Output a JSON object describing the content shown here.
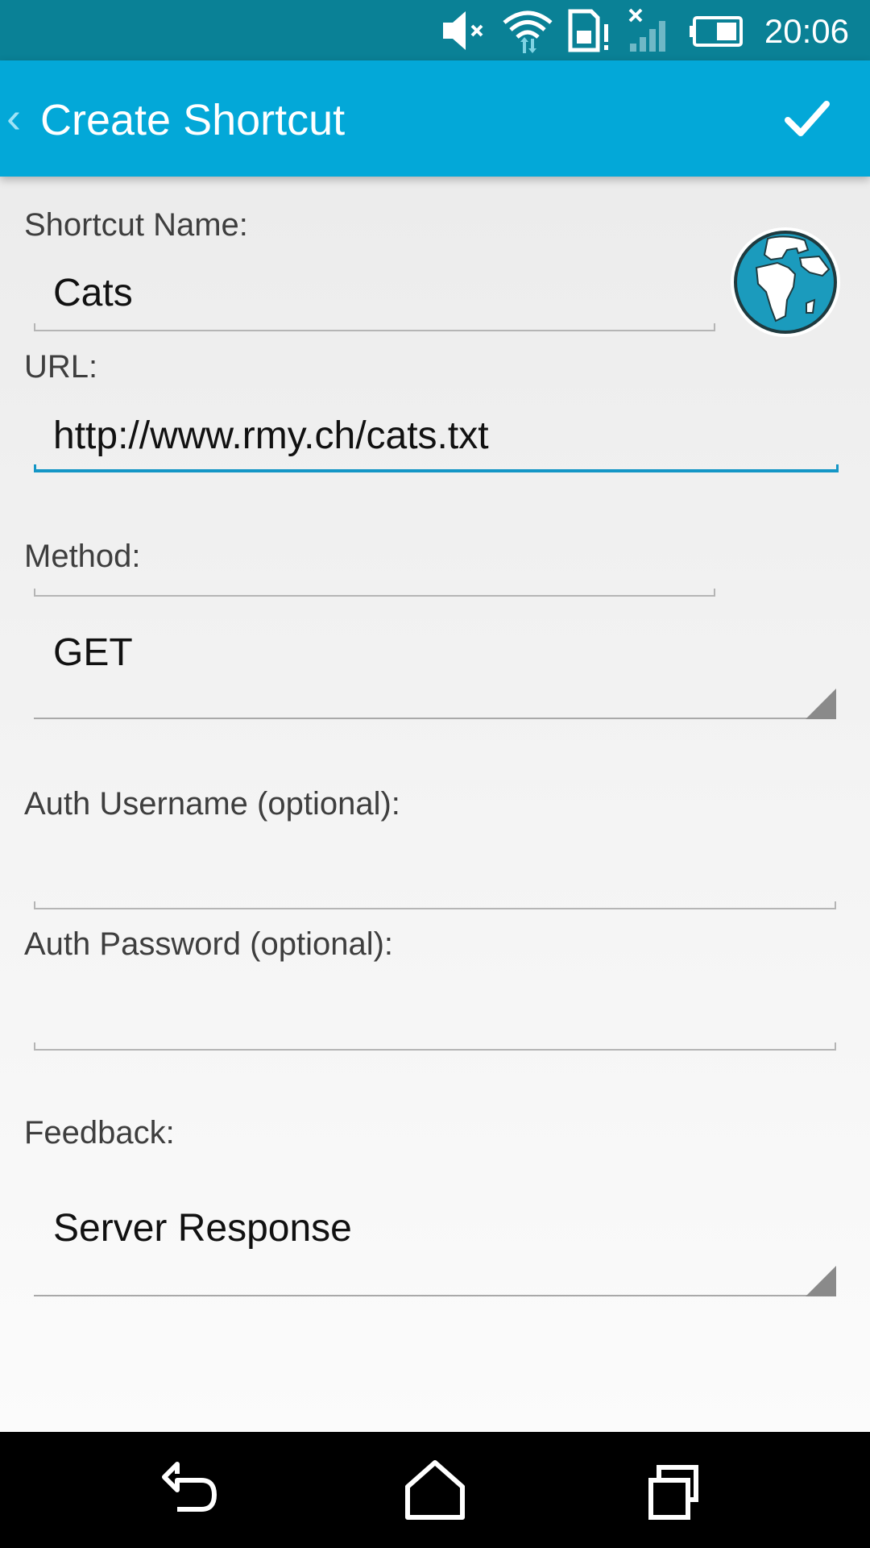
{
  "status_bar": {
    "time": "20:06",
    "icons": [
      "volume-muted-icon",
      "wifi-icon",
      "sim-alert-icon",
      "no-signal-icon",
      "battery-icon"
    ]
  },
  "action_bar": {
    "title": "Create Shortcut",
    "back_icon": "chevron-left-icon",
    "confirm_icon": "checkmark-icon",
    "background_color": "#03a8d8"
  },
  "form": {
    "shortcut_name": {
      "label": "Shortcut Name:",
      "value": "Cats"
    },
    "icon": "globe-icon",
    "url": {
      "label": "URL:",
      "value": "http://www.rmy.ch/cats.txt"
    },
    "method": {
      "label": "Method:",
      "selected": "GET"
    },
    "auth_username": {
      "label": "Auth Username (optional):",
      "value": ""
    },
    "auth_password": {
      "label": "Auth Password (optional):",
      "value": ""
    },
    "feedback": {
      "label": "Feedback:",
      "selected": "Server Response"
    }
  },
  "nav_bar": {
    "icons": [
      "back-icon",
      "home-icon",
      "recents-icon"
    ]
  },
  "colors": {
    "status_bar": "#0a8196",
    "accent": "#1496c6"
  }
}
